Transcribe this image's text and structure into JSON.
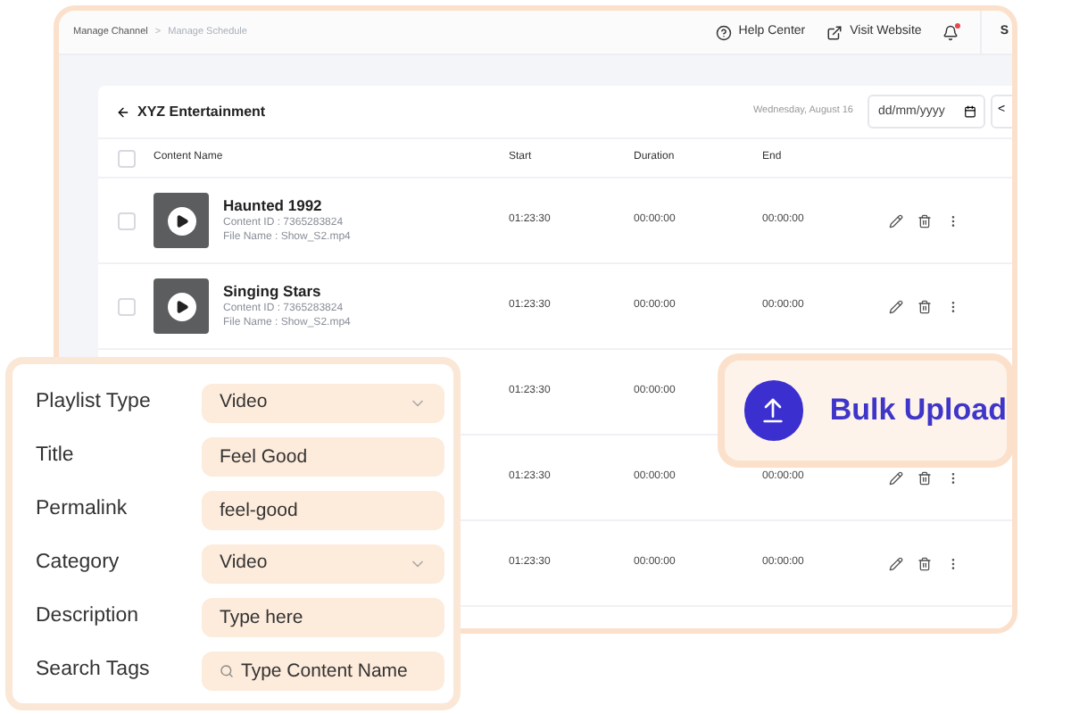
{
  "topbar": {
    "breadcrumbs": [
      {
        "label": "Manage Channel",
        "selected": false
      },
      {
        "label": "Manage Schedule",
        "selected": true
      }
    ],
    "separator": ">",
    "links": [
      {
        "kind": "help",
        "label": "Help Center"
      },
      {
        "kind": "external",
        "label": "Visit Website"
      }
    ],
    "notification": {
      "unread": true
    },
    "user_initial": "S"
  },
  "card": {
    "title": "XYZ Entertainment",
    "date": "Wednesday, August 16",
    "date_field": {
      "placeholder": "dd/mm/yyyy"
    },
    "nav_glyph": "<"
  },
  "table": {
    "all_checked": false,
    "columns": [
      "Content Name",
      "Start",
      "Duration",
      "End"
    ],
    "rows": [
      {
        "title": "Haunted 1992",
        "content_id": "Content ID : 7365283824",
        "file_name": "File Name : Show_S2.mp4",
        "start": "01:23:30",
        "duration": "00:00:00",
        "end": "00:00:00",
        "checked": false
      },
      {
        "title": "Singing Stars",
        "content_id": "Content ID : 7365283824",
        "file_name": "File Name : Show_S2.mp4",
        "start": "01:23:30",
        "duration": "00:00:00",
        "end": "00:00:00",
        "checked": false
      },
      {
        "start": "01:23:30",
        "duration": "00:00:00"
      },
      {
        "start": "01:23:30",
        "duration": "00:00:00",
        "end": "00:00:00"
      },
      {
        "start": "01:23:30",
        "duration": "00:00:00",
        "end": "00:00:00"
      }
    ]
  },
  "form": {
    "fields": [
      {
        "kind": "select",
        "label": "Playlist Type",
        "value": "Video"
      },
      {
        "kind": "text",
        "label": "Title",
        "value": "Feel Good"
      },
      {
        "kind": "text",
        "label": "Permalink",
        "value": "feel-good"
      },
      {
        "kind": "select",
        "label": "Category",
        "value": "Video"
      },
      {
        "kind": "text",
        "label": "Description",
        "placeholder": "Type here"
      },
      {
        "kind": "search",
        "label": "Search Tags",
        "placeholder": "Type Content Name"
      }
    ]
  },
  "bulk_upload": {
    "label": "Bulk Upload"
  }
}
